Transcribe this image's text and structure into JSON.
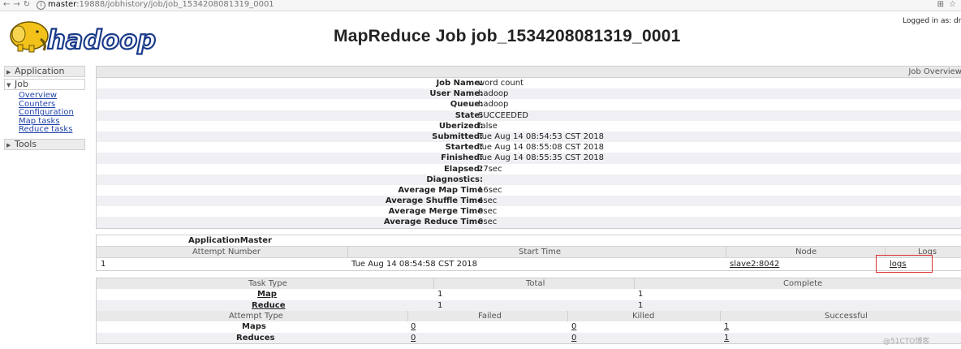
{
  "browser": {
    "url_host": "master",
    "url_path": ":19888/jobhistory/job/job_1534208081319_0001"
  },
  "header": {
    "logo_text": "hadoop",
    "title": "MapReduce Job job_1534208081319_0001",
    "logged_in": "Logged in as: dr.wh"
  },
  "nav": {
    "application": "Application",
    "job": "Job",
    "job_links": [
      "Overview",
      "Counters",
      "Configuration",
      "Map tasks",
      "Reduce tasks"
    ],
    "tools": "Tools"
  },
  "overview": {
    "heading": "Job Overview",
    "rows": [
      {
        "k": "Job Name:",
        "v": "word count"
      },
      {
        "k": "User Name:",
        "v": "hadoop"
      },
      {
        "k": "Queue:",
        "v": "hadoop"
      },
      {
        "k": "State:",
        "v": "SUCCEEDED"
      },
      {
        "k": "Uberized:",
        "v": "false"
      },
      {
        "k": "Submitted:",
        "v": "Tue Aug 14 08:54:53 CST 2018"
      },
      {
        "k": "Started:",
        "v": "Tue Aug 14 08:55:08 CST 2018"
      },
      {
        "k": "Finished:",
        "v": "Tue Aug 14 08:55:35 CST 2018"
      },
      {
        "k": "Elapsed:",
        "v": "27sec"
      },
      {
        "k": "Diagnostics:",
        "v": ""
      },
      {
        "k": "Average Map Time",
        "v": "16sec"
      },
      {
        "k": "Average Shuffle Time",
        "v": "4sec"
      },
      {
        "k": "Average Merge Time",
        "v": "0sec"
      },
      {
        "k": "Average Reduce Time",
        "v": "0sec"
      }
    ]
  },
  "app_master": {
    "title": "ApplicationMaster",
    "headers": {
      "attempt": "Attempt Number",
      "start": "Start Time",
      "node": "Node",
      "logs": "Logs"
    },
    "row": {
      "attempt": "1",
      "start": "Tue Aug 14 08:54:58 CST 2018",
      "node": "slave2:8042",
      "logs": "logs"
    }
  },
  "tasks": {
    "headers": {
      "type": "Task Type",
      "total": "Total",
      "complete": "Complete"
    },
    "rows": [
      {
        "type": "Map",
        "total": "1",
        "complete": "1"
      },
      {
        "type": "Reduce",
        "total": "1",
        "complete": "1"
      }
    ],
    "attempt_headers": {
      "type": "Attempt Type",
      "failed": "Failed",
      "killed": "Killed",
      "successful": "Successful"
    },
    "attempt_rows": [
      {
        "type": "Maps",
        "failed": "0",
        "killed": "0",
        "successful": "1"
      },
      {
        "type": "Reduces",
        "failed": "0",
        "killed": "0",
        "successful": "1"
      }
    ]
  },
  "watermark": "@51CTO博客",
  "colors": {
    "logo_blue": "#1a3a8a",
    "logo_yellow": "#f2c21b",
    "highlight_box": "#e03030"
  }
}
